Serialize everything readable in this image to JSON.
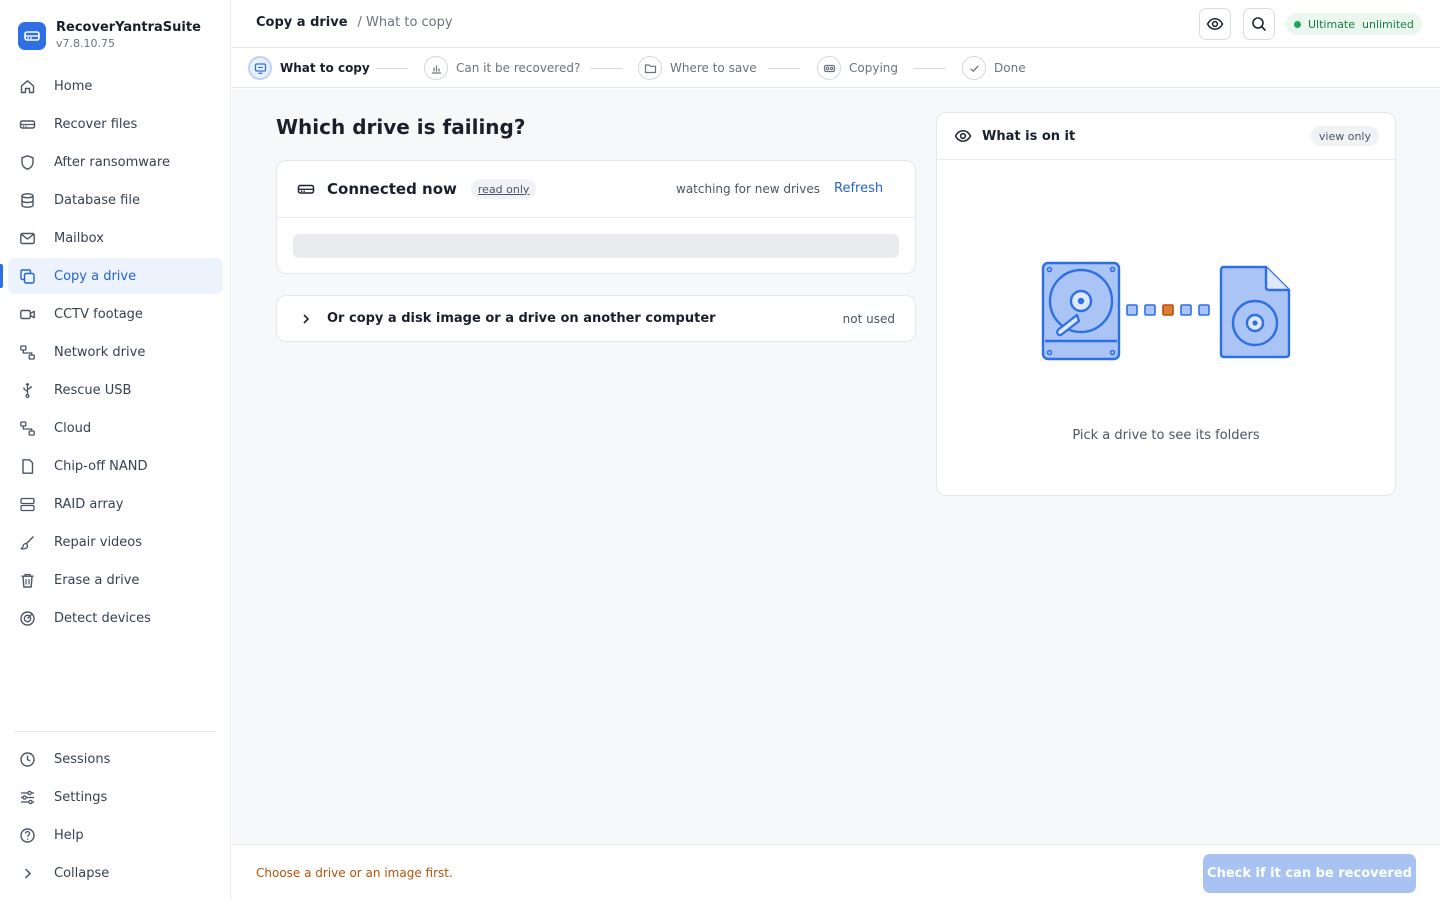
{
  "app": {
    "name": "RecoverYantraSuite",
    "version": "v7.8.10.75"
  },
  "sidebar": {
    "items": [
      {
        "label": "Home",
        "icon": "home-icon"
      },
      {
        "label": "Recover files",
        "icon": "drive-icon"
      },
      {
        "label": "After ransomware",
        "icon": "shield-icon"
      },
      {
        "label": "Database file",
        "icon": "database-icon"
      },
      {
        "label": "Mailbox",
        "icon": "mail-icon"
      },
      {
        "label": "Copy a drive",
        "icon": "copy-icon",
        "active": true
      },
      {
        "label": "CCTV footage",
        "icon": "video-camera-icon"
      },
      {
        "label": "Network drive",
        "icon": "network-icon"
      },
      {
        "label": "Rescue USB",
        "icon": "usb-icon"
      },
      {
        "label": "Cloud",
        "icon": "cloud-network-icon"
      },
      {
        "label": "Chip-off NAND",
        "icon": "file-icon"
      },
      {
        "label": "RAID array",
        "icon": "server-icon"
      },
      {
        "label": "Repair videos",
        "icon": "brush-icon"
      },
      {
        "label": "Erase a drive",
        "icon": "trash-icon"
      },
      {
        "label": "Detect devices",
        "icon": "radar-icon"
      }
    ],
    "bottom": [
      {
        "label": "Sessions",
        "icon": "clock-icon"
      },
      {
        "label": "Settings",
        "icon": "sliders-icon"
      },
      {
        "label": "Help",
        "icon": "help-icon"
      },
      {
        "label": "Collapse",
        "icon": "chevron-right-icon"
      }
    ]
  },
  "header": {
    "crumb_main": "Copy a drive",
    "crumb_sub": "/ What to copy",
    "plan": "Ultimate  unlimited"
  },
  "stepper": {
    "steps": [
      {
        "label": "What to copy",
        "active": true
      },
      {
        "label": "Can it be recovered?"
      },
      {
        "label": "Where to save"
      },
      {
        "label": "Copying"
      },
      {
        "label": "Done"
      }
    ]
  },
  "main": {
    "title": "Which drive is failing?",
    "drives_card": {
      "title": "Connected now",
      "badge": "read only",
      "watching": "watching for new drives",
      "refresh": "Refresh"
    },
    "image_card": {
      "label": "Or copy a disk image or a drive on another computer",
      "status": "not used"
    },
    "preview": {
      "title": "What is on it",
      "badge": "view only",
      "hint": "Pick a drive to see its folders"
    }
  },
  "footer": {
    "message": "Choose a drive or an image first.",
    "cta": "Check if it can be recovered"
  },
  "colors": {
    "accent": "#2f6fe4",
    "active_bg": "#edf3fd",
    "warning_text": "#b45309",
    "success": "#22a35a",
    "cta_disabled": "#a8c3f1",
    "transfer_highlight": "#e07b39"
  }
}
